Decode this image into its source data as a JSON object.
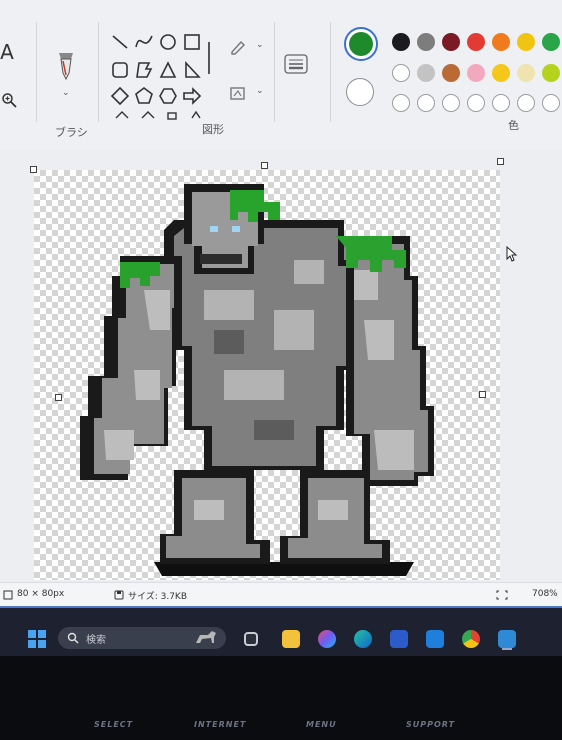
{
  "ribbon": {
    "brushes_label": "ブラシ",
    "shapes_label": "図形",
    "colors_label": "色",
    "primary_color": "#1f8a2c",
    "secondary_color": "#ffffff",
    "palette_row1": [
      "#1b1b1f",
      "#7d7d7d",
      "#7b1a24",
      "#e23b34",
      "#f07a1e",
      "#f2c412",
      "#2aa449"
    ],
    "palette_row2": [
      "#ffffff",
      "#c3c3c3",
      "#b96a35",
      "#f3a9bd",
      "#f5c71a",
      "#efe4b0",
      "#b5d31c"
    ],
    "palette_row3_empty": 7
  },
  "canvas": {
    "image_alt": "Pixel-art rock golem with green moss on head and shoulders"
  },
  "status": {
    "canvas_size": "80 × 80px",
    "file_size": "サイズ: 3.7KB",
    "zoom": "708%"
  },
  "taskbar": {
    "search_placeholder": "検索"
  },
  "bezel": {
    "labels": [
      "SELECT",
      "INTERNET",
      "MENU",
      "SUPPORT"
    ]
  }
}
